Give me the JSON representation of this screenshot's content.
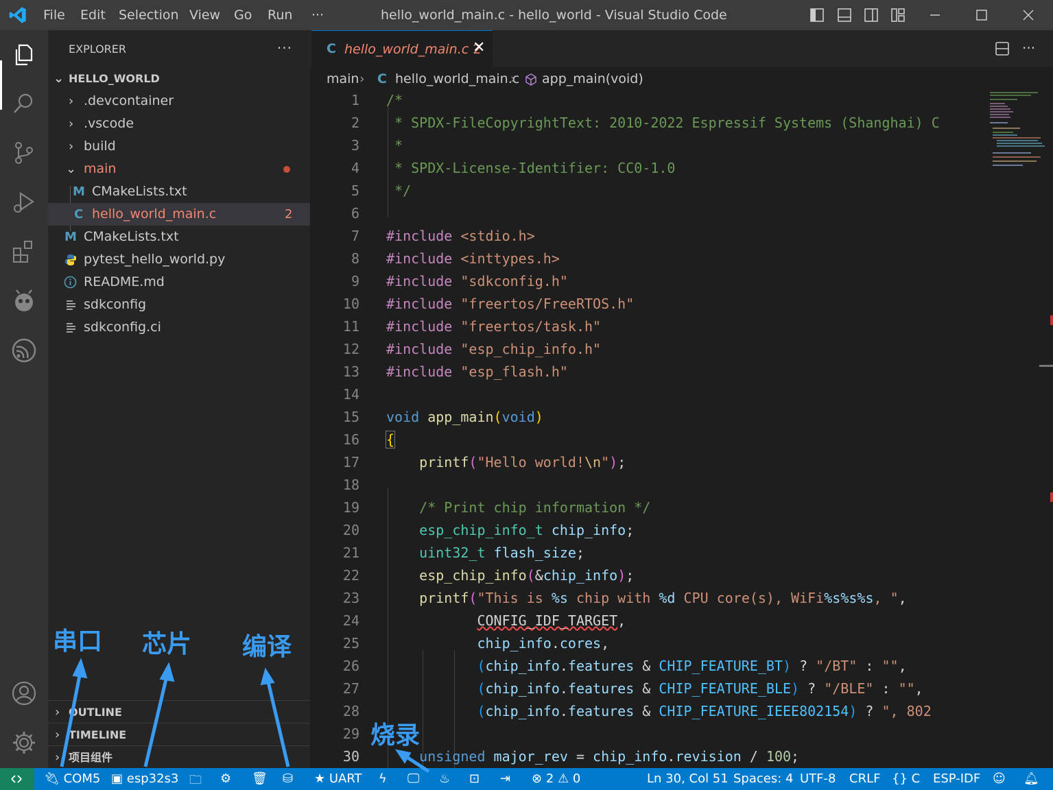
{
  "titlebar": {
    "menu": [
      "File",
      "Edit",
      "Selection",
      "View",
      "Go",
      "Run",
      "···"
    ],
    "window_title": "hello_world_main.c - hello_world - Visual Studio Code"
  },
  "sidebar": {
    "title": "EXPLORER",
    "more": "···",
    "root": "HELLO_WORLD",
    "tree": [
      {
        "label": ".devcontainer",
        "type": "folder"
      },
      {
        "label": ".vscode",
        "type": "folder"
      },
      {
        "label": "build",
        "type": "folder"
      },
      {
        "label": "main",
        "type": "folder-open"
      },
      {
        "label": "CMakeLists.txt",
        "icon": "M"
      },
      {
        "label": "hello_world_main.c",
        "icon": "C",
        "badge": "2"
      },
      {
        "label": "CMakeLists.txt",
        "icon": "M"
      },
      {
        "label": "pytest_hello_world.py",
        "icon": "python"
      },
      {
        "label": "README.md",
        "icon": "info"
      },
      {
        "label": "sdkconfig",
        "icon": "lines"
      },
      {
        "label": "sdkconfig.ci",
        "icon": "lines"
      }
    ],
    "sections": [
      "OUTLINE",
      "TIMELINE",
      "项目组件"
    ]
  },
  "editor": {
    "tab": {
      "icon": "C",
      "name": "hello_world_main.c",
      "problems": "2"
    },
    "breadcrumb": [
      "main",
      "hello_world_main.c",
      "app_main(void)"
    ],
    "current_line": 30
  },
  "annotations": {
    "serial_port": "串口",
    "chip": "芯片",
    "compile": "编译",
    "flash": "烧录"
  },
  "statusbar": {
    "port": "COM5",
    "chip": "esp32s3",
    "uart": "UART",
    "problems_errors": "2",
    "problems_warnings": "0",
    "position": "Ln 30, Col 51",
    "spaces": "Spaces: 4",
    "encoding": "UTF-8",
    "eol": "CRLF",
    "language": "C",
    "extension": "ESP-IDF"
  },
  "colors": {
    "statusbar": "#007acc",
    "remote": "#16825d",
    "activitybar": "#333333",
    "sidebar": "#252526",
    "editor": "#1e1e1e",
    "annotation": "#3a9bf2"
  }
}
